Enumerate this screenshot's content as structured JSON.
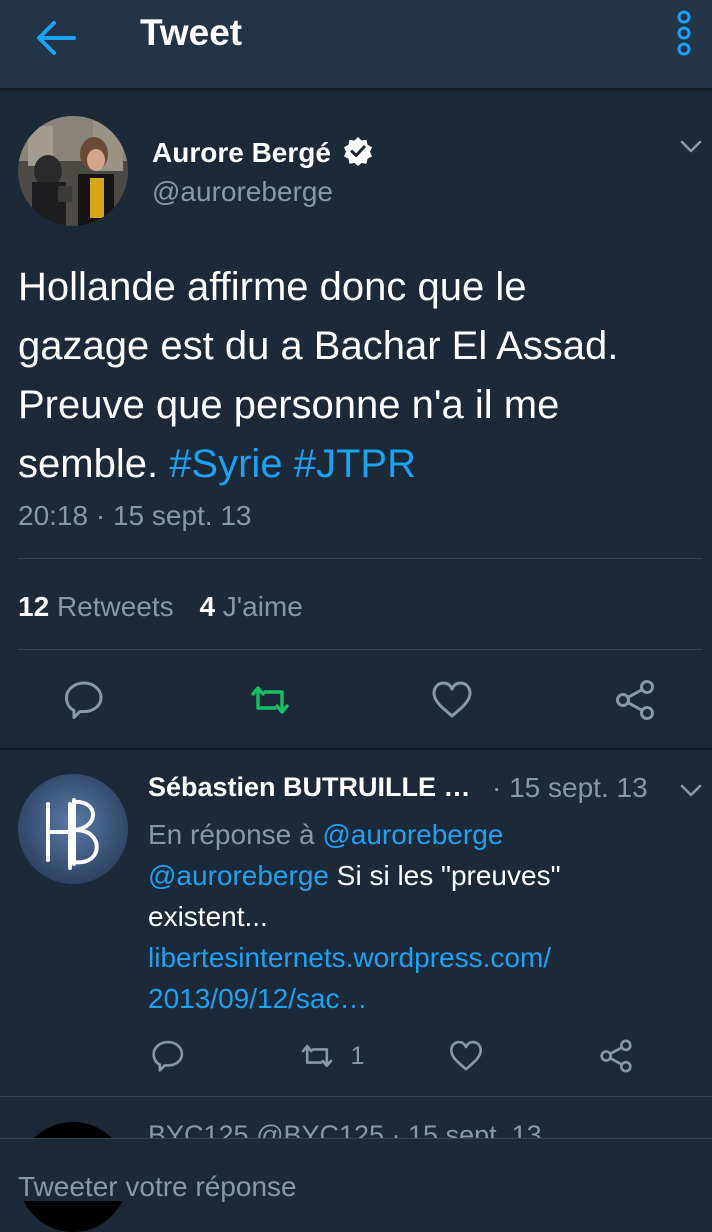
{
  "header": {
    "title": "Tweet"
  },
  "tweet": {
    "author_name": "Aurore Bergé",
    "author_handle": "@auroreberge",
    "text_lines": [
      "Hollande affirme donc que le",
      "gazage est du a Bachar El Assad.",
      "Preuve que personne n'a il me",
      "semble."
    ],
    "hashtags": [
      "#Syrie",
      "#JTPR"
    ],
    "timestamp": "20:18 · 15 sept. 13",
    "retweets_count": "12",
    "retweets_label": "Retweets",
    "likes_count": "4",
    "likes_label": "J'aime"
  },
  "reply1": {
    "avatar_initials": "HB",
    "author_name": "Sébastien BUTRUILLE …",
    "date": "· 15 sept. 13",
    "in_reply_prefix": "En réponse à",
    "in_reply_handle": "@auroreberge",
    "mention": "@auroreberge",
    "text_1": "Si si les \"preuves\"",
    "text_2": "existent...",
    "link_1": "libertesinternets.wordpress.com/",
    "link_2": "2013/09/12/sac…",
    "retweet_count": "1"
  },
  "reply2": {
    "header_text": "BYC125 @BYC125 · 15 sept. 13"
  },
  "reply_input": {
    "placeholder": "Tweeter votre réponse"
  },
  "colors": {
    "background": "#1c2938",
    "header": "#243447",
    "accent": "#1da1f2",
    "retweet_active": "#17bf63",
    "muted": "#8899a6"
  }
}
